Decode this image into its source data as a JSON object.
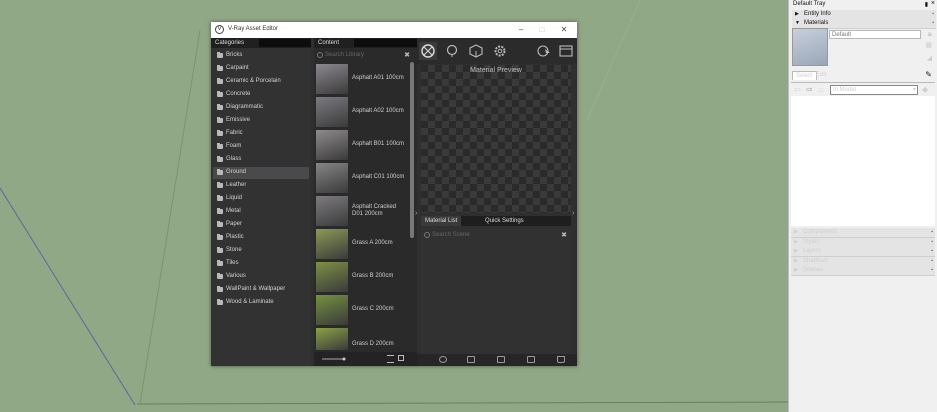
{
  "window": {
    "title": "V-Ray Asset Editor"
  },
  "columns": {
    "categories": "Categories",
    "content": "Content"
  },
  "categories": [
    {
      "label": "Bricks",
      "selected": false
    },
    {
      "label": "Carpaint",
      "selected": false
    },
    {
      "label": "Ceramic & Porcelain",
      "selected": false
    },
    {
      "label": "Concrete",
      "selected": false
    },
    {
      "label": "Diagrammatic",
      "selected": false
    },
    {
      "label": "Emissive",
      "selected": false
    },
    {
      "label": "Fabric",
      "selected": false
    },
    {
      "label": "Foam",
      "selected": false
    },
    {
      "label": "Glass",
      "selected": false
    },
    {
      "label": "Ground",
      "selected": true
    },
    {
      "label": "Leather",
      "selected": false
    },
    {
      "label": "Liquid",
      "selected": false
    },
    {
      "label": "Metal",
      "selected": false
    },
    {
      "label": "Paper",
      "selected": false
    },
    {
      "label": "Plastic",
      "selected": false
    },
    {
      "label": "Stone",
      "selected": false
    },
    {
      "label": "Tiles",
      "selected": false
    },
    {
      "label": "Various",
      "selected": false
    },
    {
      "label": "WallPaint & Wallpaper",
      "selected": false
    },
    {
      "label": "Wood & Laminate",
      "selected": false
    }
  ],
  "library_search": {
    "placeholder": "Search Library"
  },
  "assets": [
    {
      "label": "Asphalt A01 100cm",
      "color": "#8d8890"
    },
    {
      "label": "Asphalt A02 100cm",
      "color": "#7c7a80"
    },
    {
      "label": "Asphalt B01 100cm",
      "color": "#8f8b8c"
    },
    {
      "label": "Asphalt C01 100cm",
      "color": "#878587"
    },
    {
      "label": "Asphalt Cracked D01 200cm",
      "color": "#7e7b80"
    },
    {
      "label": "Grass A 200cm",
      "color": "#8a9a56"
    },
    {
      "label": "Grass B 200cm",
      "color": "#7d9045"
    },
    {
      "label": "Grass C 200cm",
      "color": "#75913f"
    },
    {
      "label": "Grass D 200cm",
      "color": "#8aa149"
    }
  ],
  "toolbar": [
    "materials-icon",
    "lights-icon",
    "geometry-icon",
    "settings-icon",
    "render-icon",
    "frame-buffer-icon"
  ],
  "preview": {
    "title": "Material Preview"
  },
  "tabs": {
    "material_list": "Material List",
    "quick_settings": "Quick Settings"
  },
  "scene_search": {
    "placeholder": "Search Scene"
  },
  "tray": {
    "title": "Default Tray",
    "entity_info": "Entity Info",
    "materials": "Materials",
    "material_name": "Default",
    "tab_select": "Select",
    "tab_edit": "Edit",
    "model_dropdown": "In Model",
    "sections": [
      "Components",
      "Styles",
      "Layers",
      "Shadows",
      "Scenes"
    ]
  }
}
